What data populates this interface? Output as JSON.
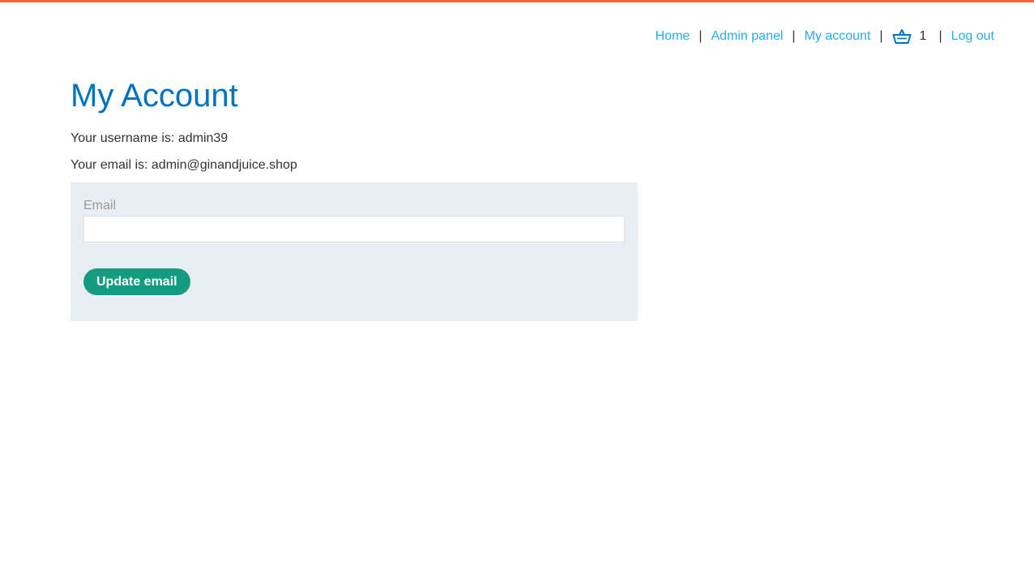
{
  "nav": {
    "home": "Home",
    "admin_panel": "Admin panel",
    "my_account": "My account",
    "cart_count": "1",
    "log_out": "Log out",
    "separator": "|",
    "cart_icon": "basket-icon"
  },
  "page": {
    "title": "My Account",
    "username_text": "Your username is: admin39",
    "email_text": "Your email is: admin@ginandjuice.shop"
  },
  "form": {
    "email_label": "Email",
    "email_value": "",
    "submit_label": "Update email"
  },
  "colors": {
    "accent_top_bar": "#ff6633",
    "link": "#29abe2",
    "title": "#0071bc",
    "button": "#159b7f",
    "panel_bg": "#e8eef1"
  }
}
